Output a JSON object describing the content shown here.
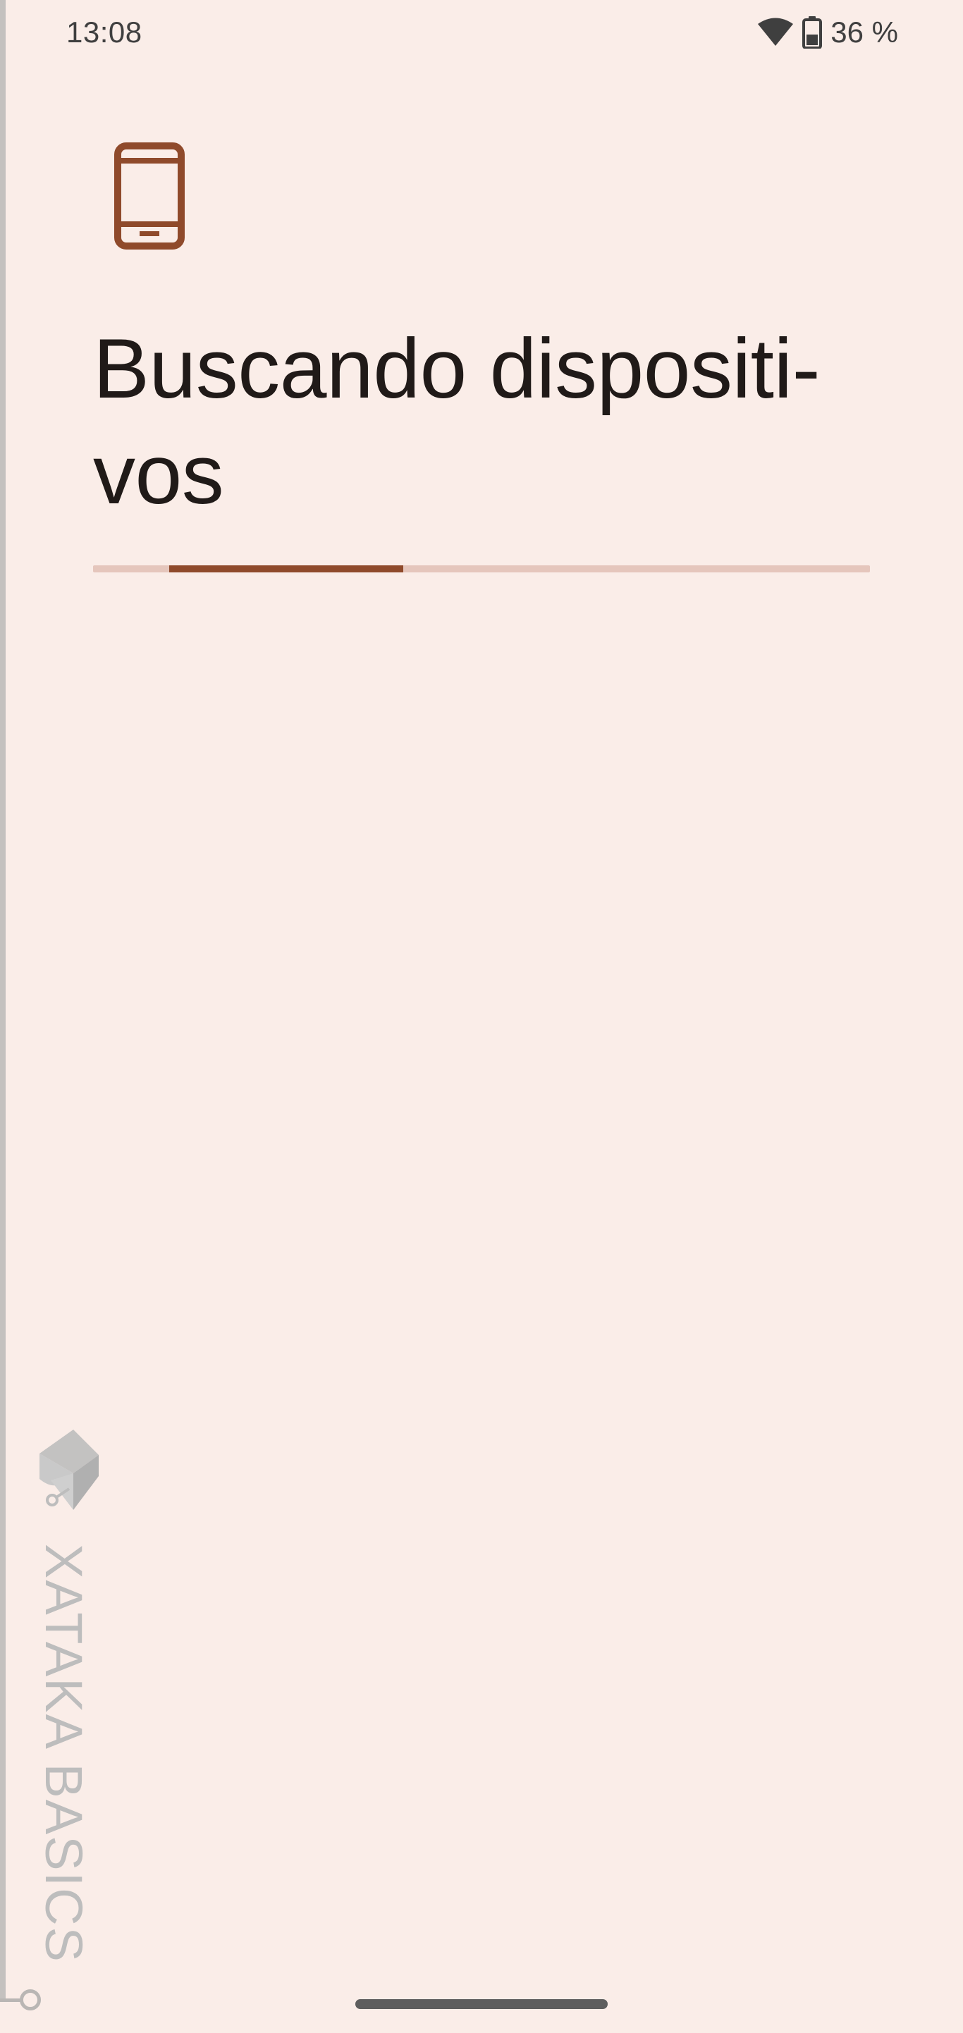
{
  "status_bar": {
    "time": "13:08",
    "battery_text": "36 %",
    "wifi_icon": "wifi-icon",
    "battery_icon": "battery-icon"
  },
  "header": {
    "icon": "phone-icon",
    "title": "Buscando dispositi-\nvos"
  },
  "progress": {
    "type": "indeterminate",
    "color_track": "#E5C6BC",
    "color_indicator": "#8F4A2B"
  },
  "watermark": {
    "text": "XATAKA BASICS",
    "logo": "xataka-basics-logo"
  },
  "colors": {
    "background": "#FAEDE8",
    "accent": "#8F4A2B",
    "title_text": "#201A18"
  }
}
